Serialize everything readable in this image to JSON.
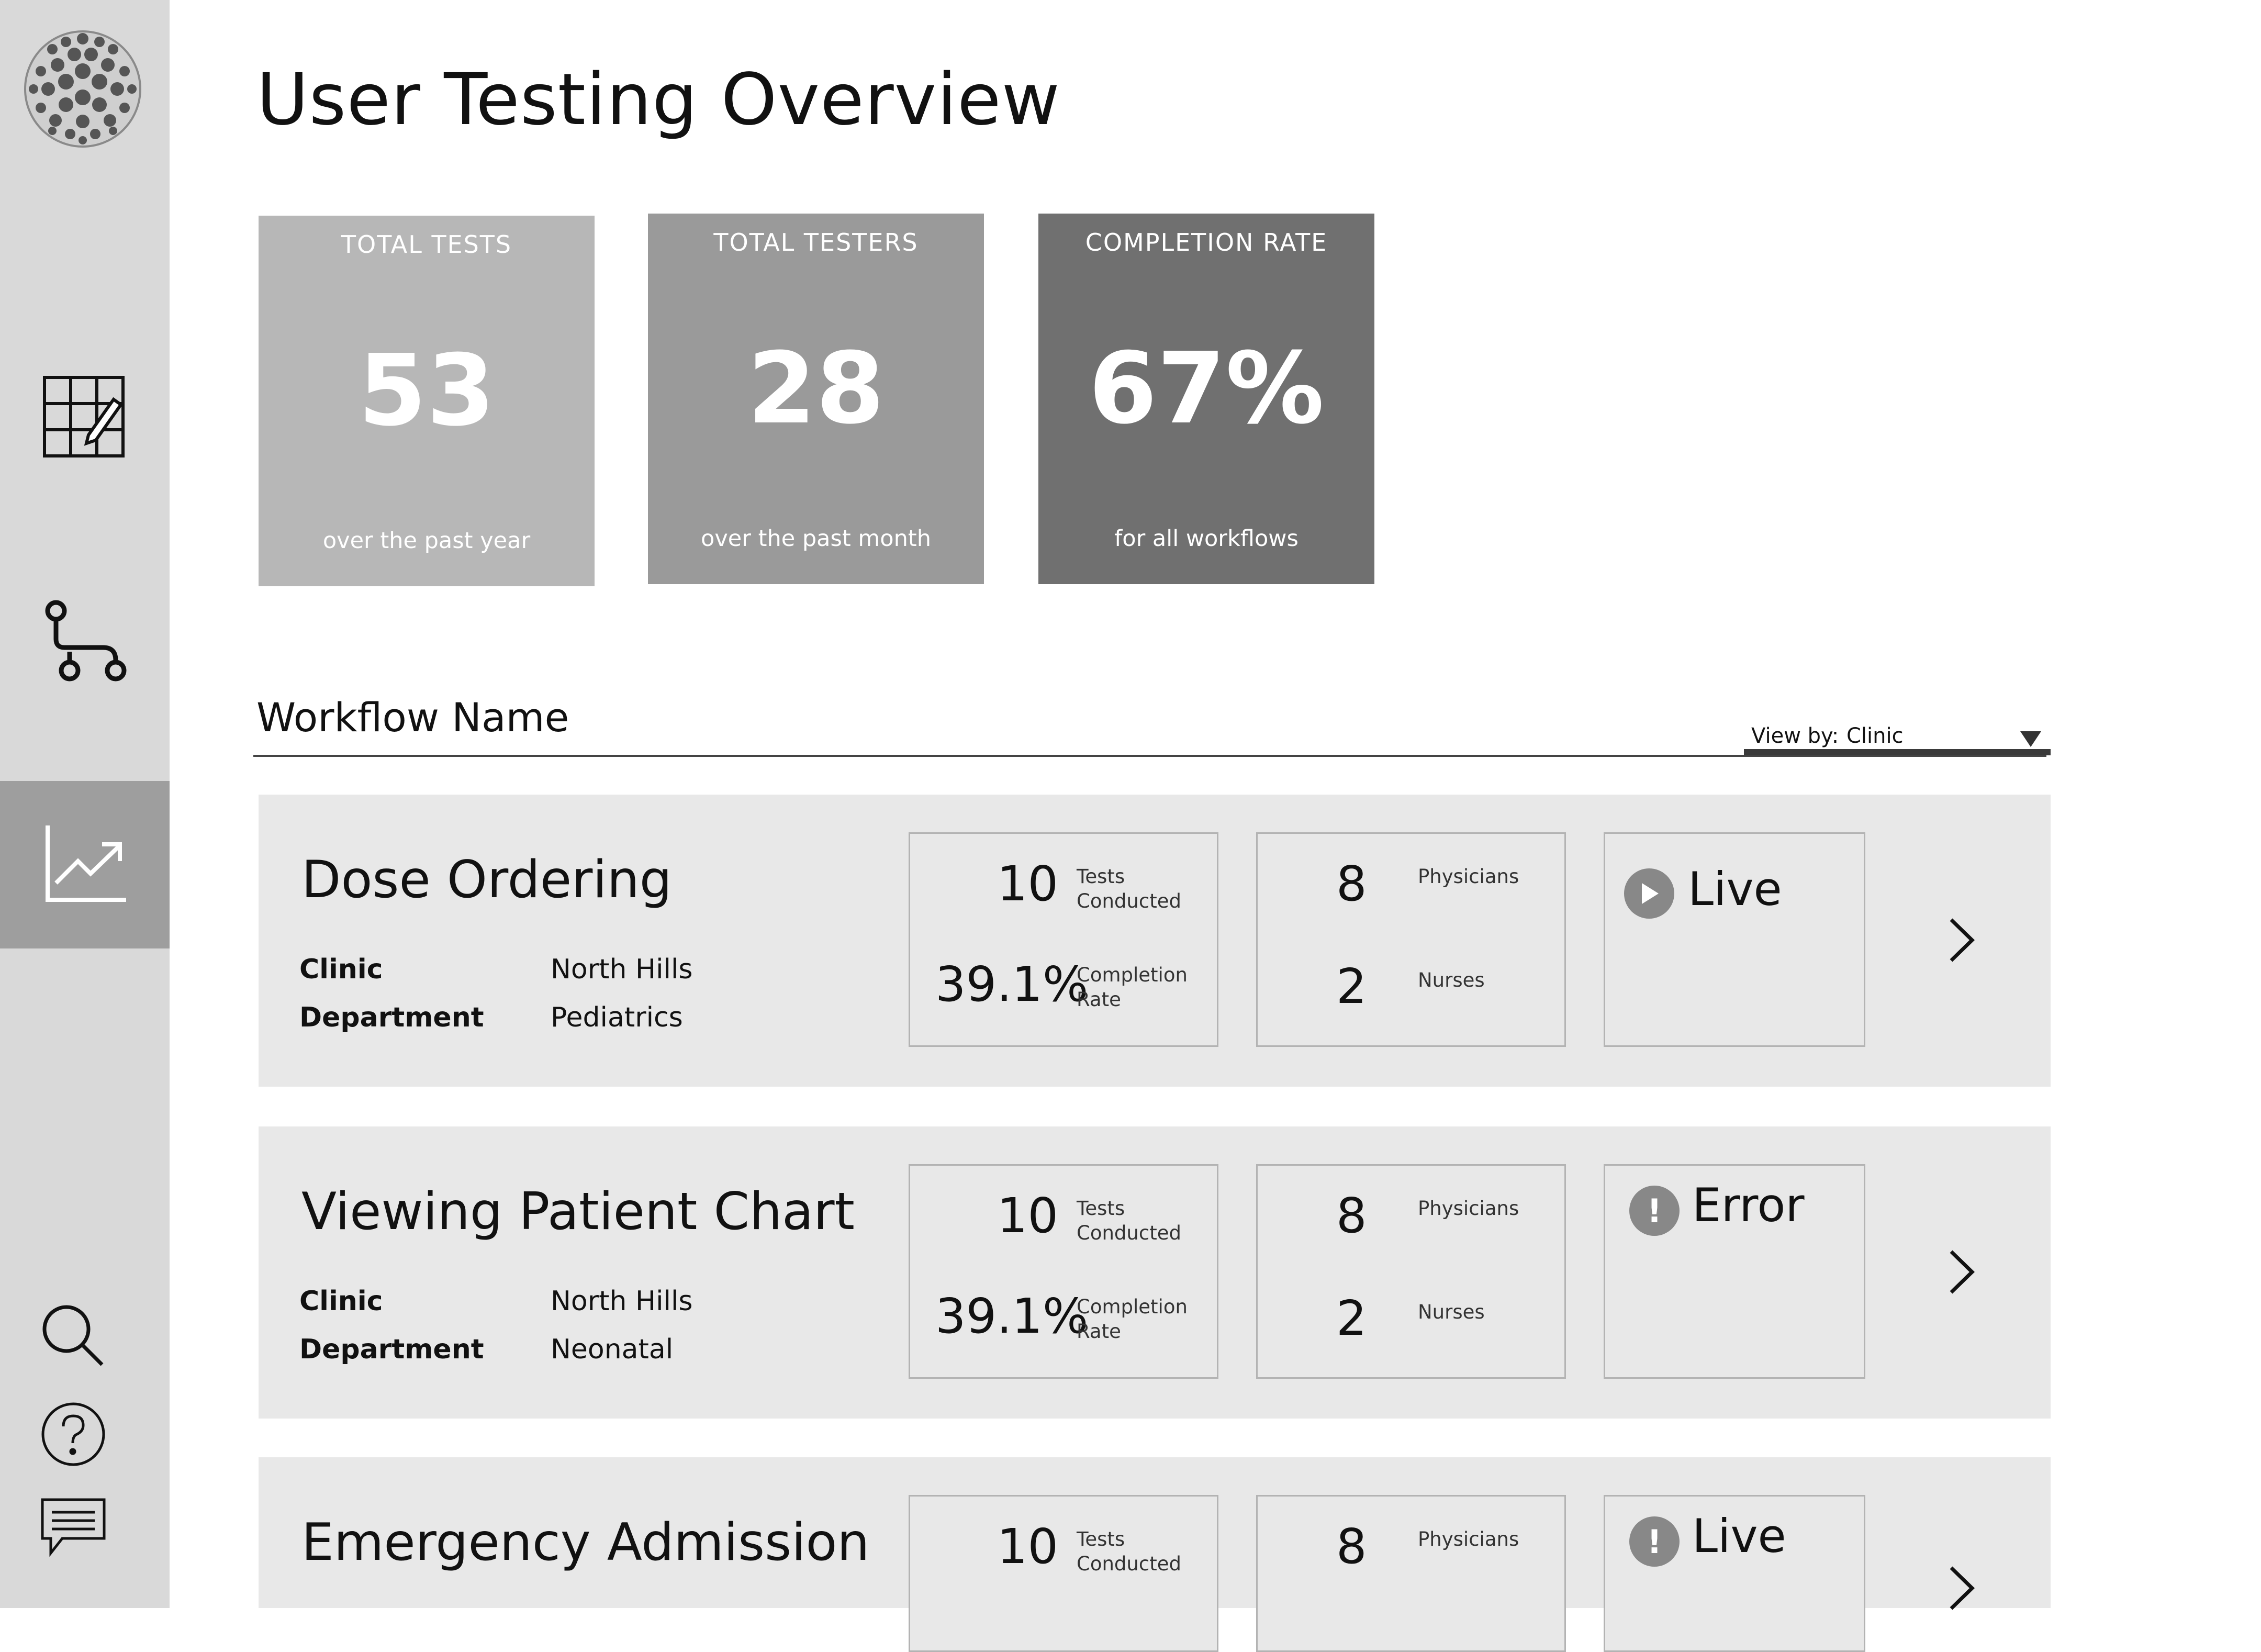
{
  "page": {
    "title": "User Testing Overview"
  },
  "sidebar": {
    "items": [
      {
        "name": "logo",
        "icon": "globe-logo"
      },
      {
        "name": "worksheet",
        "icon": "grid-edit-icon"
      },
      {
        "name": "workflows",
        "icon": "workflow-path-icon"
      },
      {
        "name": "analytics",
        "icon": "trend-chart-icon",
        "active": true
      },
      {
        "name": "search",
        "icon": "search-icon"
      },
      {
        "name": "help",
        "icon": "help-icon"
      },
      {
        "name": "feedback",
        "icon": "chat-icon"
      }
    ]
  },
  "stats": [
    {
      "label": "TOTAL TESTS",
      "value": "53",
      "note": "over the past year",
      "color": "#b7b7b7"
    },
    {
      "label": "TOTAL TESTERS",
      "value": "28",
      "note": "over the past month",
      "color": "#9a9a9a"
    },
    {
      "label": "COMPLETION RATE",
      "value": "67%",
      "note": "for all workflows",
      "color": "#707070"
    }
  ],
  "section": {
    "heading": "Workflow Name",
    "viewby_label": "View by:",
    "viewby_value": "Clinic"
  },
  "workflows": [
    {
      "name": "Dose Ordering",
      "clinic_key": "Clinic",
      "clinic": "North Hills",
      "department_key": "Department",
      "department": "Pediatrics",
      "tests": "10",
      "tests_label_1": "Tests",
      "tests_label_2": "Conducted",
      "completion": "39.1%",
      "completion_label_1": "Completion",
      "completion_label_2": "Rate",
      "physicians": "8",
      "physicians_label": "Physicians",
      "nurses": "2",
      "nurses_label": "Nurses",
      "status": "Live",
      "status_icon": "play-icon"
    },
    {
      "name": "Viewing Patient Chart",
      "clinic_key": "Clinic",
      "clinic": "North Hills",
      "department_key": "Department",
      "department": "Neonatal",
      "tests": "10",
      "tests_label_1": "Tests",
      "tests_label_2": "Conducted",
      "completion": "39.1%",
      "completion_label_1": "Completion",
      "completion_label_2": "Rate",
      "physicians": "8",
      "physicians_label": "Physicians",
      "nurses": "2",
      "nurses_label": "Nurses",
      "status": "Error",
      "status_icon": "alert-icon"
    },
    {
      "name": "Emergency Admission",
      "tests": "10",
      "tests_label_1": "Tests",
      "tests_label_2": "Conducted",
      "physicians": "8",
      "physicians_label": "Physicians",
      "status": "Live",
      "status_icon": "alert-icon"
    }
  ]
}
